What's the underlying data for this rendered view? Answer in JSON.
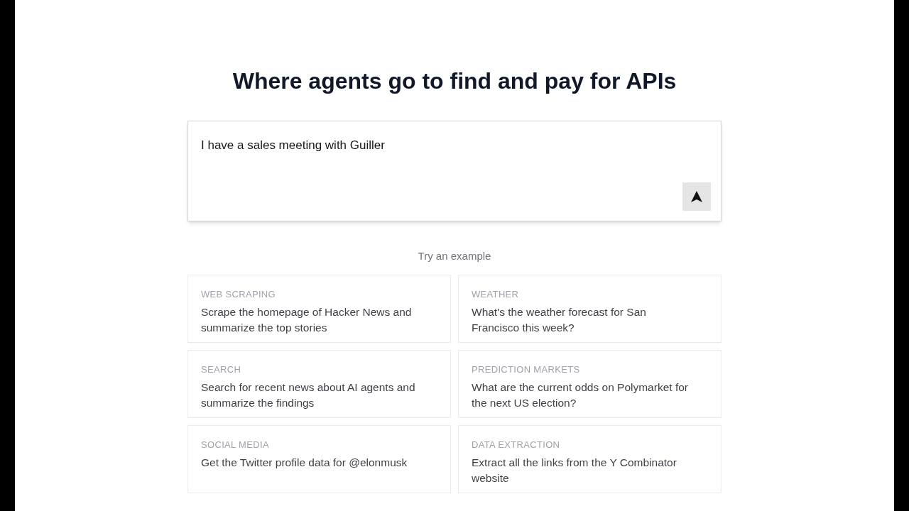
{
  "heading": "Where agents go to find and pay for APIs",
  "prompt": {
    "value": "I have a sales meeting with Guiller"
  },
  "examples_label": "Try an example",
  "examples": [
    {
      "category": "WEB SCRAPING",
      "text": "Scrape the homepage of Hacker News and summarize the top stories"
    },
    {
      "category": "WEATHER",
      "text": "What's the weather forecast for San Francisco this week?"
    },
    {
      "category": "SEARCH",
      "text": "Search for recent news about AI agents and summarize the findings"
    },
    {
      "category": "PREDICTION MARKETS",
      "text": "What are the current odds on Polymarket for the next US election?"
    },
    {
      "category": "SOCIAL MEDIA",
      "text": "Get the Twitter profile data for @elonmusk"
    },
    {
      "category": "DATA EXTRACTION",
      "text": "Extract all the links from the Y Combinator website"
    }
  ]
}
